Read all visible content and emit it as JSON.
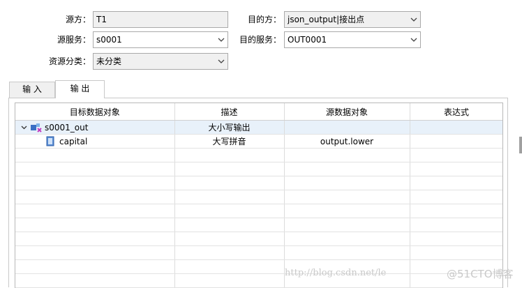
{
  "form": {
    "source_label": "源方：",
    "source_value": "T1",
    "target_label": "目的方：",
    "target_value": "json_output|接出点",
    "source_service_label": "源服务：",
    "source_service_value": "s0001",
    "target_service_label": "目的服务：",
    "target_service_value": "OUT0001",
    "category_label": "资源分类：",
    "category_value": "未分类"
  },
  "tabs": [
    {
      "label": "输 入",
      "active": false
    },
    {
      "label": "输 出",
      "active": true
    }
  ],
  "table": {
    "columns": [
      "目标数据对象",
      "描述",
      "源数据对象",
      "表达式"
    ],
    "rows": [
      {
        "name": "s0001_out",
        "desc": "大小写输出",
        "source": "",
        "expr": "",
        "selected": true,
        "icon": "structure-icon",
        "expander": "chevron-down-icon"
      },
      {
        "name": "capital",
        "desc": "大写拼音",
        "source": "output.lower",
        "expr": "",
        "selected": false,
        "icon": "field-icon",
        "expander": ""
      }
    ],
    "empty_rows": 11
  },
  "watermark": {
    "url": "http://blog.csdn.net/le",
    "brand": "@51CTO博客"
  }
}
